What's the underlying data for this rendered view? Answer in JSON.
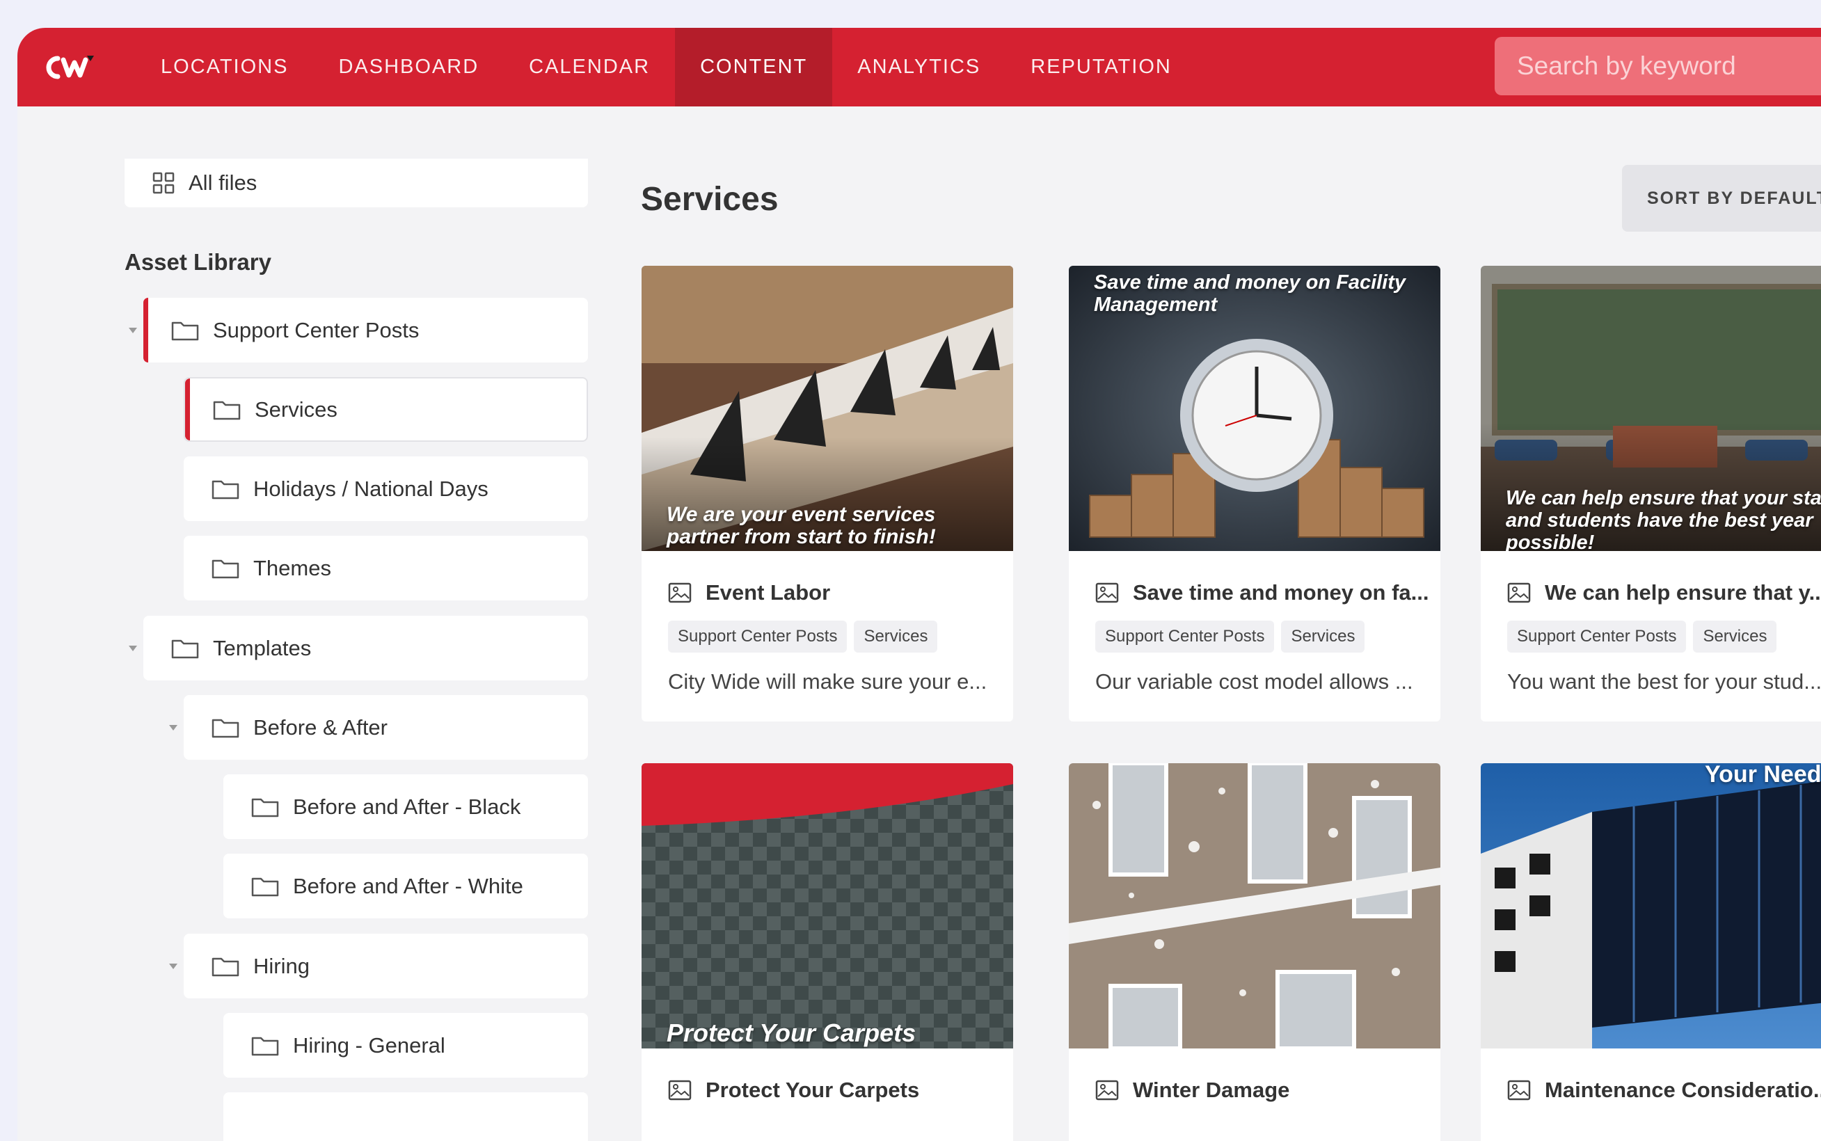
{
  "nav": {
    "items": [
      "LOCATIONS",
      "DASHBOARD",
      "CALENDAR",
      "CONTENT",
      "ANALYTICS",
      "REPUTATION"
    ],
    "active": "CONTENT",
    "search_placeholder": "Search by keyword"
  },
  "colors": {
    "brand": "#d52131",
    "brand_dark": "#b41d2a",
    "accent": "#d52131"
  },
  "sidebar": {
    "all_files": "All files",
    "library_title": "Asset Library",
    "items": [
      {
        "label": "Support Center Posts",
        "level": 0,
        "expanded": true
      },
      {
        "label": "Services",
        "level": 1,
        "selected": true
      },
      {
        "label": "Holidays / National Days",
        "level": 1
      },
      {
        "label": "Themes",
        "level": 1
      },
      {
        "label": "Templates",
        "level": 0,
        "expanded": true
      },
      {
        "label": "Before & After",
        "level": 1,
        "expanded": true
      },
      {
        "label": "Before and After - Black",
        "level": 2
      },
      {
        "label": "Before and After - White",
        "level": 2
      },
      {
        "label": "Hiring",
        "level": 1,
        "expanded": true
      },
      {
        "label": "Hiring - General",
        "level": 2
      }
    ]
  },
  "main": {
    "title": "Services",
    "sort_label": "SORT BY DEFAULT",
    "cards": [
      {
        "title": "Event Labor",
        "image_caption": "We are your event services partner from start to finish!",
        "tags": [
          "Support Center Posts",
          "Services"
        ],
        "description": "City Wide will make sure your e..."
      },
      {
        "title": "Save time and money on fa...",
        "image_caption": "Save time and money on Facility Management",
        "tags": [
          "Support Center Posts",
          "Services"
        ],
        "description": "Our variable cost model allows ..."
      },
      {
        "title": "We can help ensure that y...",
        "image_caption": "We can help ensure that your staff and students have the best year possible!",
        "tags": [
          "Support Center Posts",
          "Services"
        ],
        "description": "You want the best for your stud..."
      },
      {
        "title": "Protect Your Carpets",
        "image_caption": "Protect Your Carpets",
        "tags": [],
        "description": ""
      },
      {
        "title": "Winter Damage",
        "image_caption": "",
        "tags": [],
        "description": ""
      },
      {
        "title": "Maintenance Consideratio...",
        "image_caption": "Your Needs",
        "tags": [],
        "description": ""
      }
    ]
  }
}
